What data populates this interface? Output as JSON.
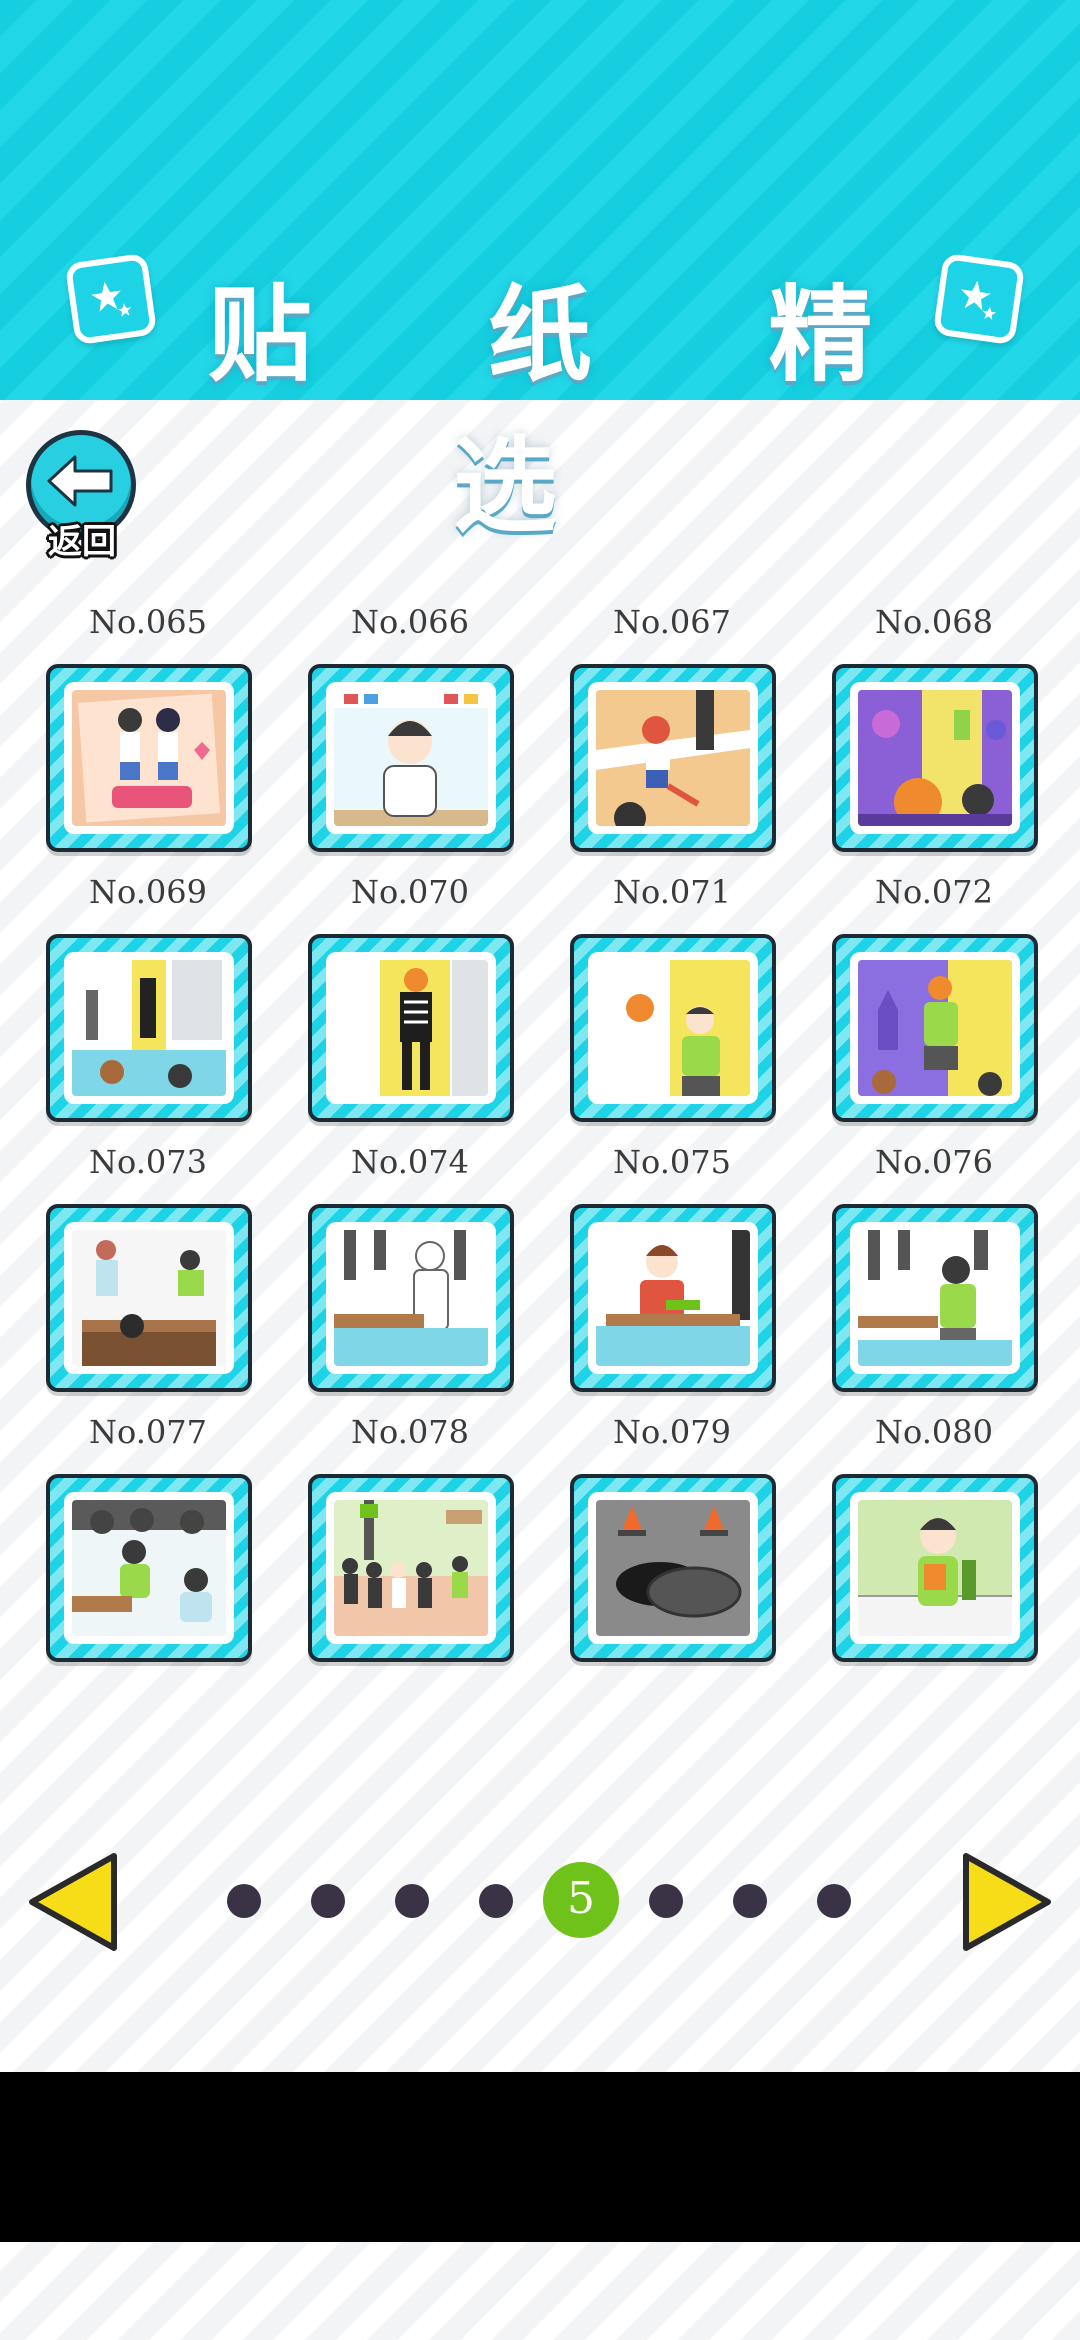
{
  "header": {
    "title": "贴 纸 精 选",
    "star_icon": "star-card-icon"
  },
  "back": {
    "label": "返回",
    "icon": "back-arrow-icon"
  },
  "stickers": [
    {
      "label": "No.065",
      "scene": "couple-poster"
    },
    {
      "label": "No.066",
      "scene": "boy-portrait"
    },
    {
      "label": "No.067",
      "scene": "race-finish"
    },
    {
      "label": "No.068",
      "scene": "halloween-party"
    },
    {
      "label": "No.069",
      "scene": "classroom-skeleton"
    },
    {
      "label": "No.070",
      "scene": "skeleton-costume"
    },
    {
      "label": "No.071",
      "scene": "pumpkin-wave"
    },
    {
      "label": "No.072",
      "scene": "pumpkin-castle"
    },
    {
      "label": "No.073",
      "scene": "classroom-jump"
    },
    {
      "label": "No.074",
      "scene": "reading-student"
    },
    {
      "label": "No.075",
      "scene": "lunch-desk"
    },
    {
      "label": "No.076",
      "scene": "classroom-back"
    },
    {
      "label": "No.077",
      "scene": "classroom-crowd"
    },
    {
      "label": "No.078",
      "scene": "bus-stop"
    },
    {
      "label": "No.079",
      "scene": "manhole-cones"
    },
    {
      "label": "No.080",
      "scene": "snack-boy"
    }
  ],
  "pager": {
    "dots": [
      "",
      "",
      "",
      "",
      "5",
      "",
      "",
      ""
    ],
    "current": "5",
    "prev_icon": "prev-arrow-icon",
    "next_icon": "next-arrow-icon"
  },
  "colors": {
    "header": "#1fd3e6",
    "active_dot": "#6fc21a",
    "dot": "#3a3346",
    "arrow": "#f7dd18"
  }
}
